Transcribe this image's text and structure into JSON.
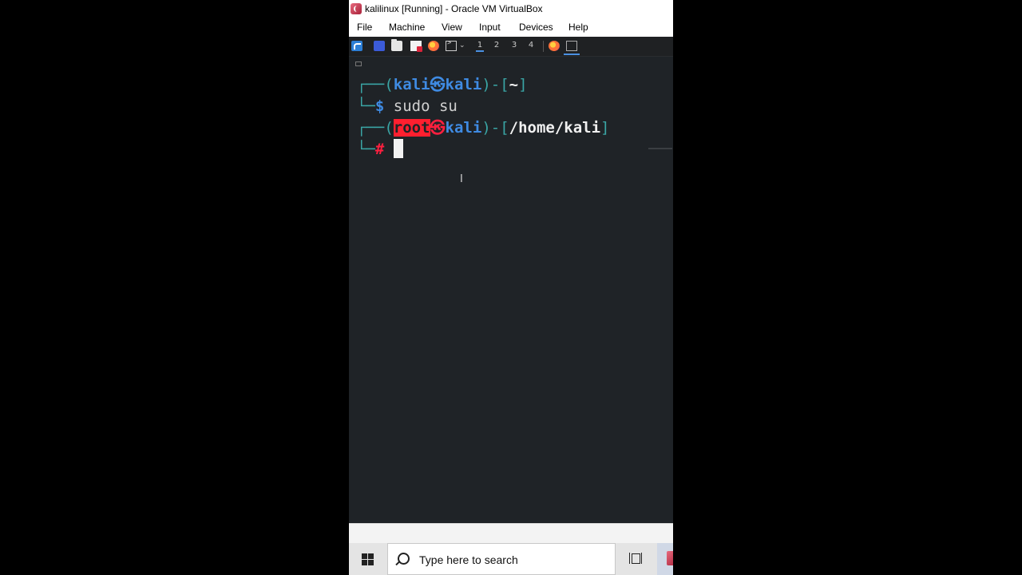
{
  "window": {
    "title": "kalilinux [Running] - Oracle VM VirtualBox",
    "icon": "virtualbox-icon"
  },
  "menubar": {
    "items": [
      "File",
      "Machine",
      "View",
      "Input",
      "Devices",
      "Help"
    ]
  },
  "panel": {
    "workspaces": [
      "1",
      "2",
      "3",
      "4"
    ],
    "active_workspace": "1",
    "icons": [
      "kali-menu-icon",
      "show-desktop-icon",
      "file-manager-icon",
      "text-editor-icon",
      "firefox-icon",
      "terminal-icon"
    ]
  },
  "terminal": {
    "line1": {
      "frame": "┌──(",
      "user": "kali",
      "at": "㉿",
      "host": "kali",
      "mid": ")-[",
      "path": "~",
      "end": "]"
    },
    "line2": {
      "frame": "└─",
      "prompt": "$",
      "command": "sudo su"
    },
    "line3": {
      "frame": "┌──(",
      "user": "root",
      "at": "㉿",
      "host": "kali",
      "mid": ")-[",
      "path": "/home/kali",
      "end": "]"
    },
    "line4": {
      "frame": "└─",
      "prompt": "#"
    }
  },
  "taskbar": {
    "search_placeholder": "Type here to search"
  }
}
